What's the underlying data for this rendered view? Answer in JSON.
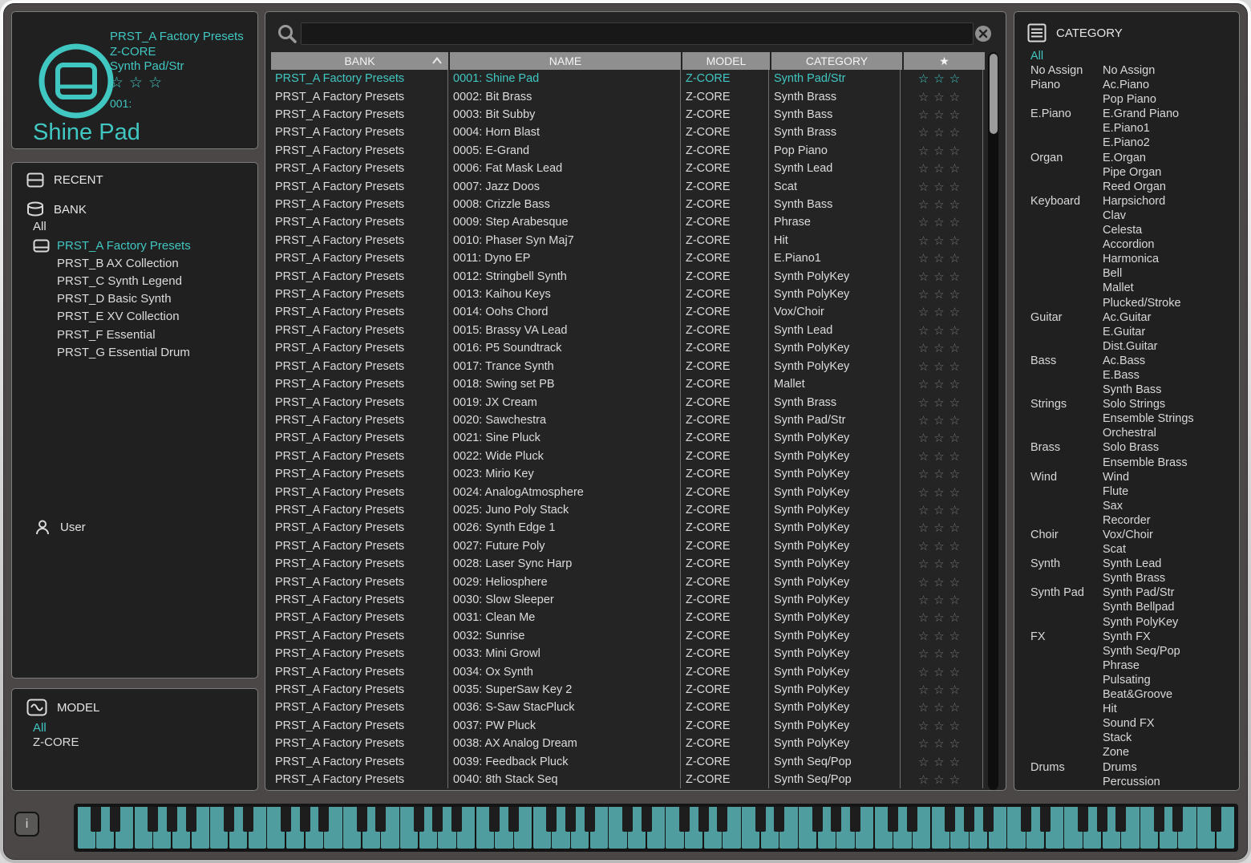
{
  "accent_color": "#41c7c2",
  "keyboard_color": "#4f9d9e",
  "preset_display": {
    "bank": "PRST_A Factory Presets",
    "model": "Z-CORE",
    "category": "Synth Pad/Str",
    "stars": 3,
    "number_label": "001:",
    "name": "Shine Pad"
  },
  "sidebar": {
    "recent_label": "RECENT",
    "bank_label": "BANK",
    "all_label": "All",
    "banks": [
      {
        "label": "PRST_A Factory Presets",
        "selected": true
      },
      {
        "label": "PRST_B AX Collection",
        "selected": false
      },
      {
        "label": "PRST_C Synth Legend",
        "selected": false
      },
      {
        "label": "PRST_D Basic Synth",
        "selected": false
      },
      {
        "label": "PRST_E XV Collection",
        "selected": false
      },
      {
        "label": "PRST_F Essential",
        "selected": false
      },
      {
        "label": "PRST_G Essential Drum",
        "selected": false
      }
    ],
    "user_label": "User"
  },
  "model_panel": {
    "title": "MODEL",
    "items": [
      {
        "label": "All",
        "selected": true
      },
      {
        "label": "Z-CORE",
        "selected": false
      }
    ]
  },
  "search": {
    "value": ""
  },
  "table": {
    "columns": {
      "bank": "BANK",
      "name": "NAME",
      "model": "MODEL",
      "category": "CATEGORY",
      "star": "★"
    },
    "stars_per_row": 3,
    "rows": [
      {
        "bank": "PRST_A Factory Presets",
        "name": "0001: Shine Pad",
        "model": "Z-CORE",
        "category": "Synth Pad/Str",
        "selected": true
      },
      {
        "bank": "PRST_A Factory Presets",
        "name": "0002: Bit Brass",
        "model": "Z-CORE",
        "category": "Synth Brass",
        "selected": false
      },
      {
        "bank": "PRST_A Factory Presets",
        "name": "0003: Bit Subby",
        "model": "Z-CORE",
        "category": "Synth Bass",
        "selected": false
      },
      {
        "bank": "PRST_A Factory Presets",
        "name": "0004: Horn Blast",
        "model": "Z-CORE",
        "category": "Synth Brass",
        "selected": false
      },
      {
        "bank": "PRST_A Factory Presets",
        "name": "0005: E-Grand",
        "model": "Z-CORE",
        "category": "Pop Piano",
        "selected": false
      },
      {
        "bank": "PRST_A Factory Presets",
        "name": "0006: Fat Mask Lead",
        "model": "Z-CORE",
        "category": "Synth Lead",
        "selected": false
      },
      {
        "bank": "PRST_A Factory Presets",
        "name": "0007: Jazz Doos",
        "model": "Z-CORE",
        "category": "Scat",
        "selected": false
      },
      {
        "bank": "PRST_A Factory Presets",
        "name": "0008: Crizzle Bass",
        "model": "Z-CORE",
        "category": "Synth Bass",
        "selected": false
      },
      {
        "bank": "PRST_A Factory Presets",
        "name": "0009: Step Arabesque",
        "model": "Z-CORE",
        "category": "Phrase",
        "selected": false
      },
      {
        "bank": "PRST_A Factory Presets",
        "name": "0010: Phaser Syn Maj7",
        "model": "Z-CORE",
        "category": "Hit",
        "selected": false
      },
      {
        "bank": "PRST_A Factory Presets",
        "name": "0011: Dyno EP",
        "model": "Z-CORE",
        "category": "E.Piano1",
        "selected": false
      },
      {
        "bank": "PRST_A Factory Presets",
        "name": "0012: Stringbell Synth",
        "model": "Z-CORE",
        "category": "Synth PolyKey",
        "selected": false
      },
      {
        "bank": "PRST_A Factory Presets",
        "name": "0013: Kaihou Keys",
        "model": "Z-CORE",
        "category": "Synth PolyKey",
        "selected": false
      },
      {
        "bank": "PRST_A Factory Presets",
        "name": "0014: Oohs Chord",
        "model": "Z-CORE",
        "category": "Vox/Choir",
        "selected": false
      },
      {
        "bank": "PRST_A Factory Presets",
        "name": "0015: Brassy VA Lead",
        "model": "Z-CORE",
        "category": "Synth Lead",
        "selected": false
      },
      {
        "bank": "PRST_A Factory Presets",
        "name": "0016: P5 Soundtrack",
        "model": "Z-CORE",
        "category": "Synth PolyKey",
        "selected": false
      },
      {
        "bank": "PRST_A Factory Presets",
        "name": "0017: Trance Synth",
        "model": "Z-CORE",
        "category": "Synth PolyKey",
        "selected": false
      },
      {
        "bank": "PRST_A Factory Presets",
        "name": "0018: Swing set PB",
        "model": "Z-CORE",
        "category": "Mallet",
        "selected": false
      },
      {
        "bank": "PRST_A Factory Presets",
        "name": "0019: JX Cream",
        "model": "Z-CORE",
        "category": "Synth Brass",
        "selected": false
      },
      {
        "bank": "PRST_A Factory Presets",
        "name": "0020: Sawchestra",
        "model": "Z-CORE",
        "category": "Synth Pad/Str",
        "selected": false
      },
      {
        "bank": "PRST_A Factory Presets",
        "name": "0021: Sine Pluck",
        "model": "Z-CORE",
        "category": "Synth PolyKey",
        "selected": false
      },
      {
        "bank": "PRST_A Factory Presets",
        "name": "0022: Wide Pluck",
        "model": "Z-CORE",
        "category": "Synth PolyKey",
        "selected": false
      },
      {
        "bank": "PRST_A Factory Presets",
        "name": "0023: Mirio Key",
        "model": "Z-CORE",
        "category": "Synth PolyKey",
        "selected": false
      },
      {
        "bank": "PRST_A Factory Presets",
        "name": "0024: AnalogAtmosphere",
        "model": "Z-CORE",
        "category": "Synth PolyKey",
        "selected": false
      },
      {
        "bank": "PRST_A Factory Presets",
        "name": "0025: Juno Poly Stack",
        "model": "Z-CORE",
        "category": "Synth PolyKey",
        "selected": false
      },
      {
        "bank": "PRST_A Factory Presets",
        "name": "0026: Synth Edge 1",
        "model": "Z-CORE",
        "category": "Synth PolyKey",
        "selected": false
      },
      {
        "bank": "PRST_A Factory Presets",
        "name": "0027: Future Poly",
        "model": "Z-CORE",
        "category": "Synth PolyKey",
        "selected": false
      },
      {
        "bank": "PRST_A Factory Presets",
        "name": "0028: Laser Sync Harp",
        "model": "Z-CORE",
        "category": "Synth PolyKey",
        "selected": false
      },
      {
        "bank": "PRST_A Factory Presets",
        "name": "0029: Heliosphere",
        "model": "Z-CORE",
        "category": "Synth PolyKey",
        "selected": false
      },
      {
        "bank": "PRST_A Factory Presets",
        "name": "0030: Slow Sleeper",
        "model": "Z-CORE",
        "category": "Synth PolyKey",
        "selected": false
      },
      {
        "bank": "PRST_A Factory Presets",
        "name": "0031: Clean Me",
        "model": "Z-CORE",
        "category": "Synth PolyKey",
        "selected": false
      },
      {
        "bank": "PRST_A Factory Presets",
        "name": "0032: Sunrise",
        "model": "Z-CORE",
        "category": "Synth PolyKey",
        "selected": false
      },
      {
        "bank": "PRST_A Factory Presets",
        "name": "0033: Mini Growl",
        "model": "Z-CORE",
        "category": "Synth PolyKey",
        "selected": false
      },
      {
        "bank": "PRST_A Factory Presets",
        "name": "0034: Ox Synth",
        "model": "Z-CORE",
        "category": "Synth PolyKey",
        "selected": false
      },
      {
        "bank": "PRST_A Factory Presets",
        "name": "0035: SuperSaw Key 2",
        "model": "Z-CORE",
        "category": "Synth PolyKey",
        "selected": false
      },
      {
        "bank": "PRST_A Factory Presets",
        "name": "0036: S-Saw StacPluck",
        "model": "Z-CORE",
        "category": "Synth PolyKey",
        "selected": false
      },
      {
        "bank": "PRST_A Factory Presets",
        "name": "0037: PW Pluck",
        "model": "Z-CORE",
        "category": "Synth PolyKey",
        "selected": false
      },
      {
        "bank": "PRST_A Factory Presets",
        "name": "0038: AX Analog Dream",
        "model": "Z-CORE",
        "category": "Synth PolyKey",
        "selected": false
      },
      {
        "bank": "PRST_A Factory Presets",
        "name": "0039: Feedback Pluck",
        "model": "Z-CORE",
        "category": "Synth Seq/Pop",
        "selected": false
      },
      {
        "bank": "PRST_A Factory Presets",
        "name": "0040: 8th Stack Seq",
        "model": "Z-CORE",
        "category": "Synth Seq/Pop",
        "selected": false
      }
    ]
  },
  "category_panel": {
    "title": "CATEGORY",
    "all_label": "All",
    "groups": [
      {
        "label": "No Assign",
        "subs": [
          "No Assign"
        ]
      },
      {
        "label": "Piano",
        "subs": [
          "Ac.Piano",
          "Pop Piano"
        ]
      },
      {
        "label": "E.Piano",
        "subs": [
          "E.Grand Piano",
          "E.Piano1",
          "E.Piano2"
        ]
      },
      {
        "label": "Organ",
        "subs": [
          "E.Organ",
          "Pipe Organ",
          "Reed Organ"
        ]
      },
      {
        "label": "Keyboard",
        "subs": [
          "Harpsichord",
          "Clav",
          "Celesta",
          "Accordion",
          "Harmonica",
          "Bell",
          "Mallet",
          "Plucked/Stroke"
        ]
      },
      {
        "label": "Guitar",
        "subs": [
          "Ac.Guitar",
          "E.Guitar",
          "Dist.Guitar"
        ]
      },
      {
        "label": "Bass",
        "subs": [
          "Ac.Bass",
          "E.Bass",
          "Synth Bass"
        ]
      },
      {
        "label": "Strings",
        "subs": [
          "Solo Strings",
          "Ensemble Strings",
          "Orchestral"
        ]
      },
      {
        "label": "Brass",
        "subs": [
          "Solo Brass",
          "Ensemble Brass"
        ]
      },
      {
        "label": "Wind",
        "subs": [
          "Wind",
          "Flute",
          "Sax",
          "Recorder"
        ]
      },
      {
        "label": "Choir",
        "subs": [
          "Vox/Choir",
          "Scat"
        ]
      },
      {
        "label": "Synth",
        "subs": [
          "Synth Lead",
          "Synth Brass"
        ]
      },
      {
        "label": "Synth Pad",
        "subs": [
          "Synth Pad/Str",
          "Synth Bellpad",
          "Synth PolyKey"
        ]
      },
      {
        "label": "FX",
        "subs": [
          "Synth FX",
          "Synth Seq/Pop",
          "Phrase",
          "Pulsating",
          "Beat&Groove",
          "Hit",
          "Sound FX",
          "Stack",
          "Zone"
        ]
      },
      {
        "label": "Drums",
        "subs": [
          "Drums",
          "Percussion"
        ]
      }
    ]
  },
  "keyboard": {
    "white_key_count": 61,
    "start_note": "C"
  },
  "info_button_label": "i",
  "star_glyphs": {
    "empty": "☆",
    "header": "★"
  }
}
